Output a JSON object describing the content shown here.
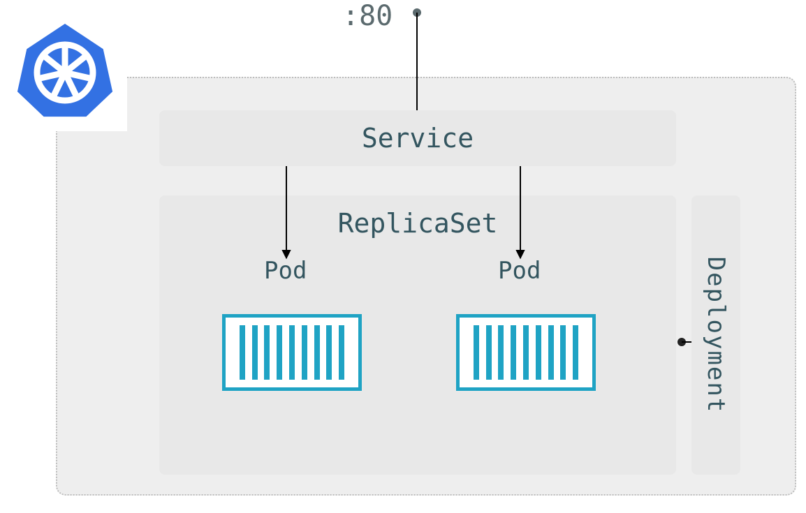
{
  "port_label": ":80",
  "service": {
    "label": "Service"
  },
  "replicaset": {
    "label": "ReplicaSet",
    "pods": [
      {
        "label": "Pod"
      },
      {
        "label": "Pod"
      }
    ]
  },
  "deployment": {
    "label": "Deployment"
  },
  "colors": {
    "container": "#1fa3c4",
    "text": "#33555f",
    "panel_bg": "#eeeeee",
    "box_bg": "#e8e8e8",
    "logo": "#3371e3"
  }
}
